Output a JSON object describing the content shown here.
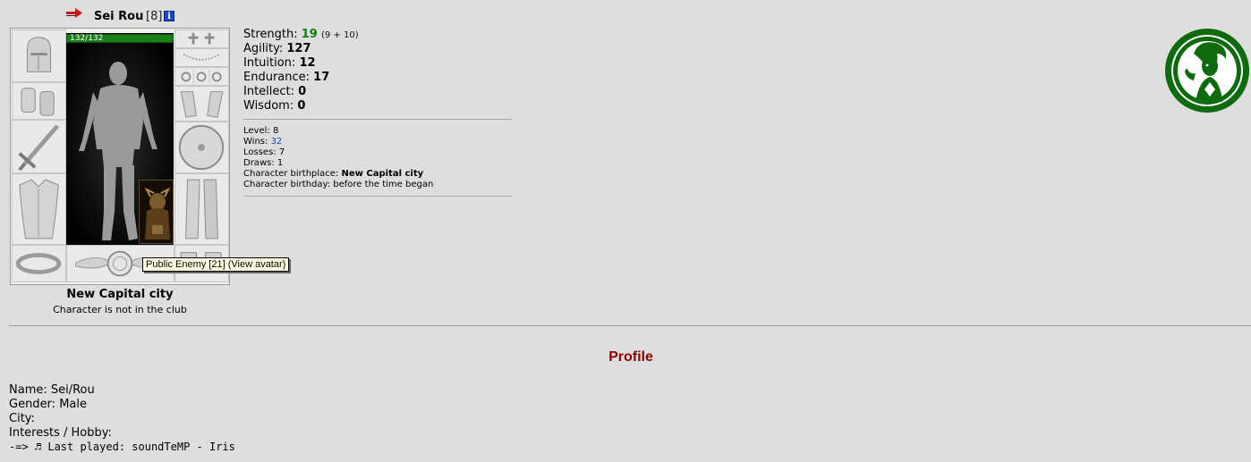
{
  "character": {
    "name": "Sei Rou",
    "level": "[8]",
    "info_icon": "i",
    "hp": "132/132",
    "hp_fraction": 1.0,
    "tooltip": "Public Enemy [21] (View avatar)",
    "city": "New Capital city",
    "club_status": "Character is not in the club"
  },
  "stats": {
    "strength": {
      "label": "Strength:",
      "value": "19",
      "detail": "(9 + 10)"
    },
    "agility": {
      "label": "Agility:",
      "value": "127"
    },
    "intuition": {
      "label": "Intuition:",
      "value": "12"
    },
    "endurance": {
      "label": "Endurance:",
      "value": "17"
    },
    "intellect": {
      "label": "Intellect:",
      "value": "0"
    },
    "wisdom": {
      "label": "Wisdom:",
      "value": "0"
    }
  },
  "info": {
    "level": {
      "label": "Level:",
      "value": "8"
    },
    "wins": {
      "label": "Wins:",
      "value": "32"
    },
    "losses": {
      "label": "Losses:",
      "value": "7"
    },
    "draws": {
      "label": "Draws:",
      "value": "1"
    },
    "birthplace": {
      "label": "Character birthplace:",
      "value": "New Capital city"
    },
    "birthday": {
      "label": "Character birthday:",
      "value": "before the time began"
    }
  },
  "profile": {
    "title": "Profile",
    "name": "Name: Sei/Rou",
    "gender": "Gender: Male",
    "city": "City:",
    "interests": "Interests / Hobby:",
    "last_played": "-=> ♬ Last played: soundTeMP - Iris"
  },
  "colors": {
    "accent_red": "#8b0000",
    "stat_green": "#127a12",
    "emblem_green": "#0d6b0d",
    "link_blue": "#1b3fb0"
  },
  "icons": [
    "arrow-icon",
    "info-icon",
    "helmet-icon",
    "bracers-icon",
    "sword-icon",
    "armor-icon",
    "belt-icon",
    "earrings-icon",
    "amulet-icon",
    "rings-icon",
    "gloves-icon",
    "shield-icon",
    "greaves-icon",
    "boots-icon",
    "clan-emblem-icon"
  ]
}
